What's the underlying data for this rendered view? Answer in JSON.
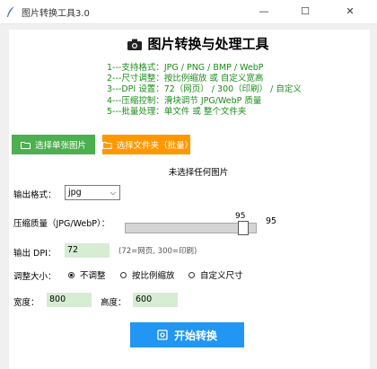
{
  "window": {
    "title": "图片转换工具3.0",
    "min": "—",
    "max": "☐",
    "close": "✕"
  },
  "header": {
    "title": "图片转换与处理工具"
  },
  "features": [
    "1---支持格式：JPG / PNG / BMP / WebP",
    "2---尺寸调整：按比例缩放 或 自定义宽高",
    "3---DPI 设置：72（网页） / 300（印刷） / 自定义",
    "4---压缩控制：滑块调节 JPG/WebP 质量",
    "5---批量处理：单文件 或 整个文件夹"
  ],
  "buttons": {
    "select_single": "选择单张图片",
    "select_folder": "选择文件夹（批量）",
    "start": "开始转换"
  },
  "status": "未选择任何图片",
  "output_format": {
    "label": "输出格式：",
    "value": "jpg"
  },
  "quality": {
    "label": "压缩质量（JPG/WebP）：",
    "value": 95,
    "value_text": "95",
    "min": 1,
    "max": 100
  },
  "dpi": {
    "label": "输出 DPI：",
    "value": "72",
    "hint": "(72=网页, 300=印刷)"
  },
  "resize": {
    "label": "调整大小：",
    "options": [
      "不调整",
      "按比例缩放",
      "自定义尺寸"
    ],
    "selected": 0
  },
  "size": {
    "width_label": "宽度：",
    "width_value": "800",
    "height_label": "高度：",
    "height_value": "600"
  },
  "colors": {
    "green_button": "#4caf50",
    "orange_button": "#ff9800",
    "blue_button": "#2196f3",
    "feature_text": "#1a8c1a",
    "entry_bg": "#d6ecd3"
  }
}
